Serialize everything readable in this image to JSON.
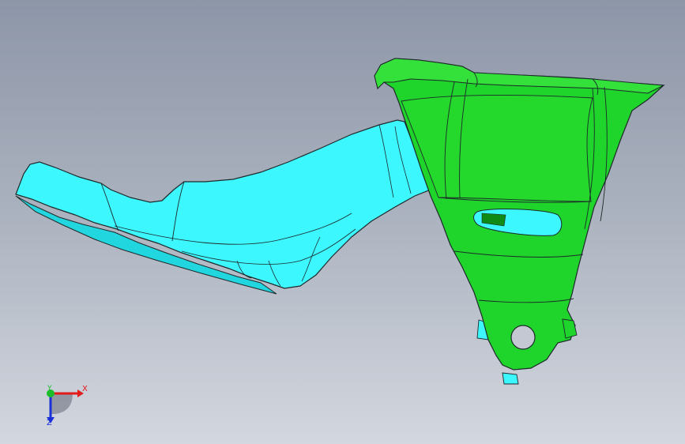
{
  "viewport": {
    "background_top": "#8d96a8",
    "background_bottom": "#d3d7df"
  },
  "model": {
    "part_cyan_color": "#3df7ff",
    "part_green_color": "#19d61d",
    "edge_color": "#1d2a2a"
  },
  "triad": {
    "x_label": "X",
    "y_label": "Y",
    "z_label": "Z",
    "x_color": "#e21b1b",
    "y_color": "#1bbd2b",
    "z_color": "#1b2fd6"
  }
}
